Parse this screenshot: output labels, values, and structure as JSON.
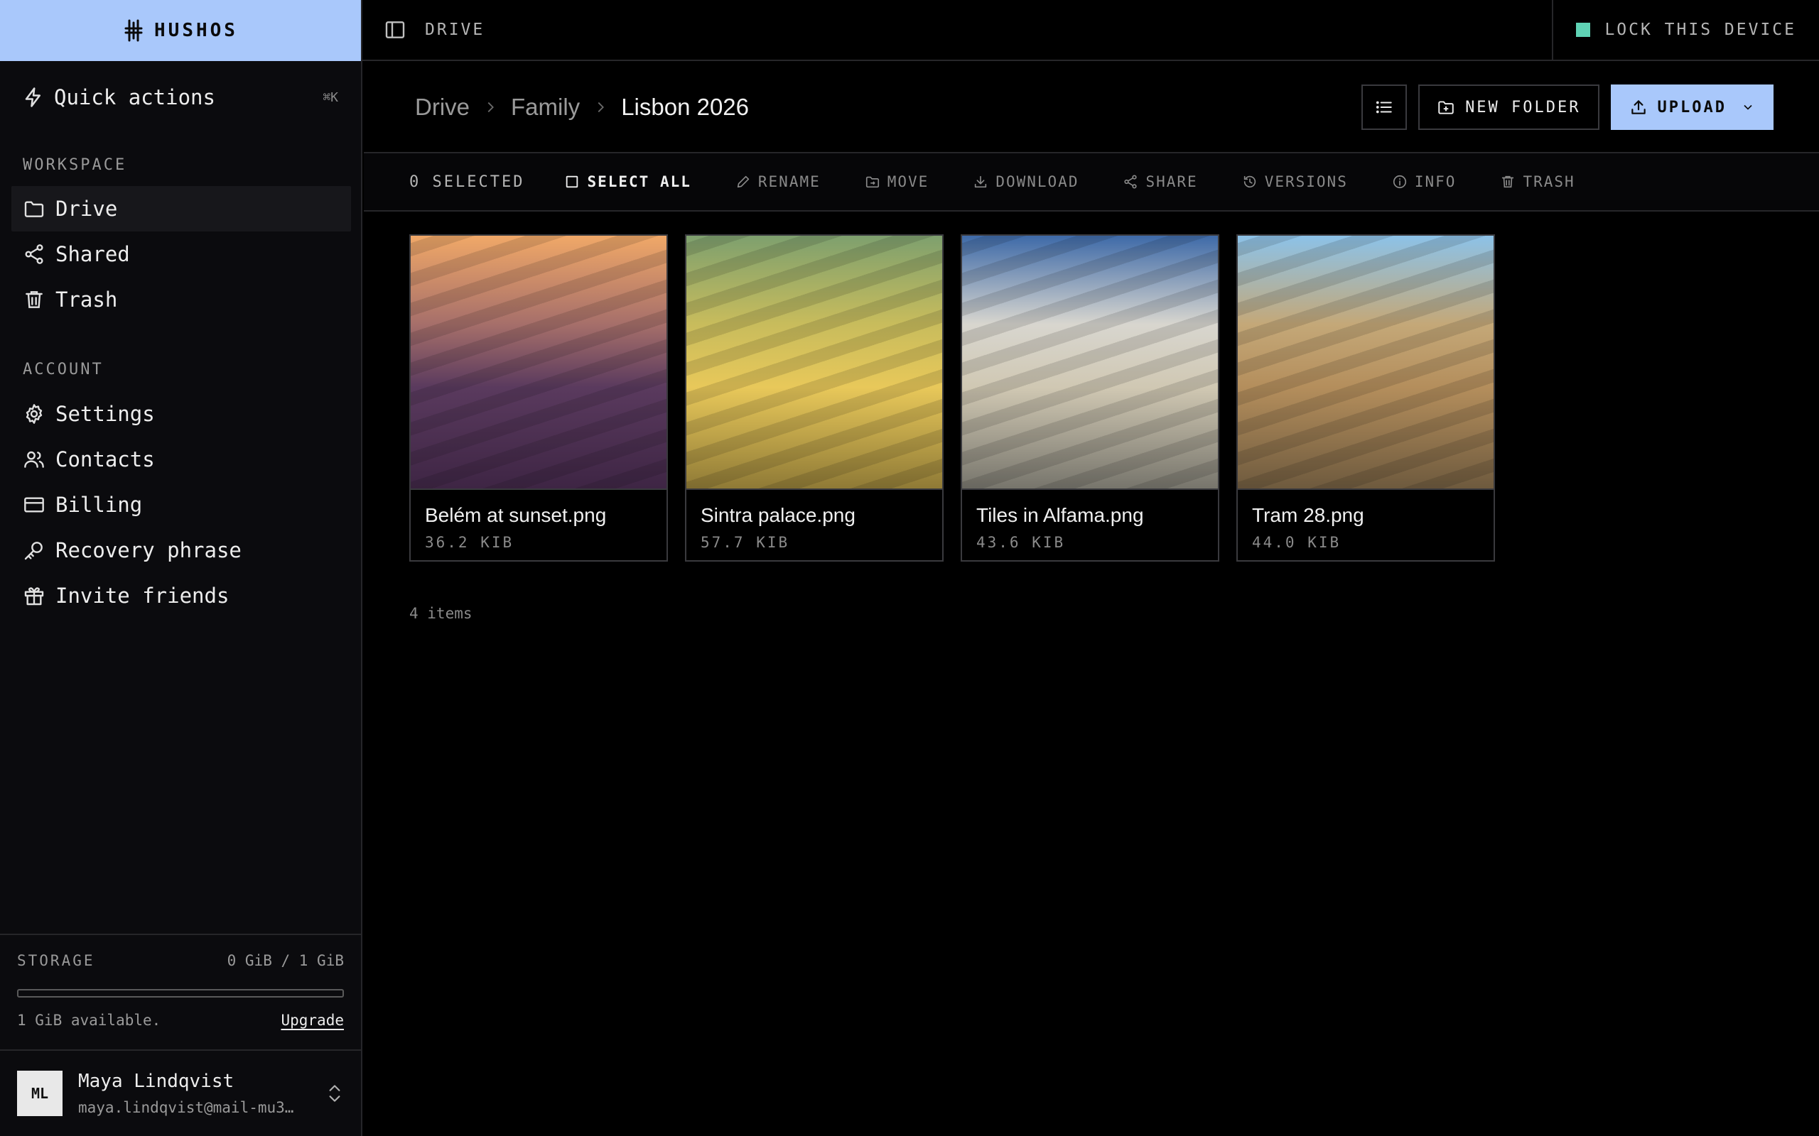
{
  "brand": {
    "name": "HUSHOS"
  },
  "quick_actions": {
    "label": "Quick actions",
    "shortcut": "⌘K"
  },
  "sidebar": {
    "workspace_label": "WORKSPACE",
    "workspace_items": [
      {
        "label": "Drive",
        "icon": "folder-icon",
        "active": true
      },
      {
        "label": "Shared",
        "icon": "share-icon"
      },
      {
        "label": "Trash",
        "icon": "trash-icon"
      }
    ],
    "account_label": "ACCOUNT",
    "account_items": [
      {
        "label": "Settings",
        "icon": "gear-icon"
      },
      {
        "label": "Contacts",
        "icon": "users-icon"
      },
      {
        "label": "Billing",
        "icon": "credit-card-icon"
      },
      {
        "label": "Recovery phrase",
        "icon": "key-icon"
      },
      {
        "label": "Invite friends",
        "icon": "gift-icon"
      }
    ]
  },
  "storage": {
    "label": "STORAGE",
    "usage": "0 GiB / 1 GiB",
    "used_fraction": 0,
    "available": "1 GiB available.",
    "upgrade_label": "Upgrade"
  },
  "user": {
    "initials": "ML",
    "name": "Maya Lindqvist",
    "email": "maya.lindqvist@mail-mu3…"
  },
  "topbar": {
    "title": "DRIVE",
    "lock_label": "LOCK THIS DEVICE",
    "lock_color": "#5fd3b5"
  },
  "breadcrumb": [
    "Drive",
    "Family",
    "Lisbon 2026"
  ],
  "header_actions": {
    "new_folder": "NEW FOLDER",
    "upload": "UPLOAD"
  },
  "toolbar": {
    "selected": "0 SELECTED",
    "select_all": "SELECT ALL",
    "rename": "RENAME",
    "move": "MOVE",
    "download": "DOWNLOAD",
    "share": "SHARE",
    "versions": "VERSIONS",
    "info": "INFO",
    "trash": "TRASH"
  },
  "files": [
    {
      "name": "Belém at sunset.png",
      "size": "36.2 KIB",
      "colors": [
        "#f0a868",
        "#a66f6a",
        "#5a3a5e",
        "#3e2544"
      ]
    },
    {
      "name": "Sintra palace.png",
      "size": "57.7 KIB",
      "colors": [
        "#7ea06e",
        "#c8bc5c",
        "#e8c85a",
        "#8f7a36"
      ]
    },
    {
      "name": "Tiles in Alfama.png",
      "size": "43.6 KIB",
      "colors": [
        "#3e6aa8",
        "#d8d6cf",
        "#d0c8b3",
        "#77756c"
      ]
    },
    {
      "name": "Tram 28.png",
      "size": "44.0 KIB",
      "colors": [
        "#8cc2e8",
        "#c4a878",
        "#b48e5c",
        "#6e5a3e"
      ]
    }
  ],
  "item_count": "4 items",
  "accent": "#a9c8fb"
}
